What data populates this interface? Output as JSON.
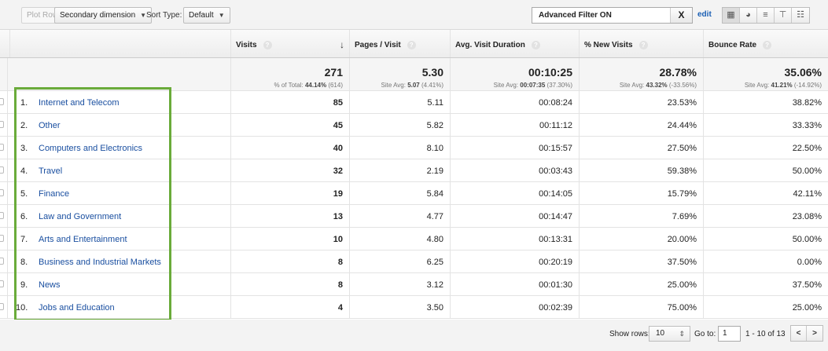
{
  "toolbar": {
    "plot_rows": "Plot Rows",
    "secondary_dimension": "Secondary dimension",
    "sort_type_label": "Sort Type:",
    "sort_type_value": "Default",
    "filter_text": "Advanced Filter ON",
    "filter_clear": "X",
    "edit_label": "edit"
  },
  "columns": {
    "visits": "Visits",
    "pages_per_visit": "Pages / Visit",
    "avg_visit_duration": "Avg. Visit Duration",
    "new_visits": "% New Visits",
    "bounce_rate": "Bounce Rate"
  },
  "totals": {
    "visits": "271",
    "visits_sub_prefix": "% of Total: ",
    "visits_sub_bold": "44.14%",
    "visits_sub_suffix": " (614)",
    "pages_per_visit": "5.30",
    "pages_sub_prefix": "Site Avg: ",
    "pages_sub_bold": "5.07",
    "pages_sub_suffix": " (4.41%)",
    "duration": "00:10:25",
    "duration_sub_prefix": "Site Avg: ",
    "duration_sub_bold": "00:07:35",
    "duration_sub_suffix": " (37.30%)",
    "new_visits": "28.78%",
    "new_sub_prefix": "Site Avg: ",
    "new_sub_bold": "43.32%",
    "new_sub_suffix": " (-33.56%)",
    "bounce_rate": "35.06%",
    "bounce_sub_prefix": "Site Avg: ",
    "bounce_sub_bold": "41.21%",
    "bounce_sub_suffix": " (-14.92%)"
  },
  "rows": [
    {
      "rank": "1.",
      "category": "Internet and Telecom",
      "visits": "85",
      "pages": "5.11",
      "duration": "00:08:24",
      "new": "23.53%",
      "bounce": "38.82%"
    },
    {
      "rank": "2.",
      "category": "Other",
      "visits": "45",
      "pages": "5.82",
      "duration": "00:11:12",
      "new": "24.44%",
      "bounce": "33.33%"
    },
    {
      "rank": "3.",
      "category": "Computers and Electronics",
      "visits": "40",
      "pages": "8.10",
      "duration": "00:15:57",
      "new": "27.50%",
      "bounce": "22.50%"
    },
    {
      "rank": "4.",
      "category": "Travel",
      "visits": "32",
      "pages": "2.19",
      "duration": "00:03:43",
      "new": "59.38%",
      "bounce": "50.00%"
    },
    {
      "rank": "5.",
      "category": "Finance",
      "visits": "19",
      "pages": "5.84",
      "duration": "00:14:05",
      "new": "15.79%",
      "bounce": "42.11%"
    },
    {
      "rank": "6.",
      "category": "Law and Government",
      "visits": "13",
      "pages": "4.77",
      "duration": "00:14:47",
      "new": "7.69%",
      "bounce": "23.08%"
    },
    {
      "rank": "7.",
      "category": "Arts and Entertainment",
      "visits": "10",
      "pages": "4.80",
      "duration": "00:13:31",
      "new": "20.00%",
      "bounce": "50.00%"
    },
    {
      "rank": "8.",
      "category": "Business and Industrial Markets",
      "visits": "8",
      "pages": "6.25",
      "duration": "00:20:19",
      "new": "37.50%",
      "bounce": "0.00%"
    },
    {
      "rank": "9.",
      "category": "News",
      "visits": "8",
      "pages": "3.12",
      "duration": "00:01:30",
      "new": "25.00%",
      "bounce": "37.50%"
    },
    {
      "rank": "10.",
      "category": "Jobs and Education",
      "visits": "4",
      "pages": "3.50",
      "duration": "00:02:39",
      "new": "75.00%",
      "bounce": "25.00%"
    }
  ],
  "footer": {
    "show_rows_label": "Show rows:",
    "show_rows_value": "10",
    "goto_label": "Go to:",
    "goto_value": "1",
    "range": "1 - 10 of 13",
    "prev": "<",
    "next": ">"
  },
  "colors": {
    "link": "#1a4fa0",
    "highlight_box": "#6aab3a"
  }
}
